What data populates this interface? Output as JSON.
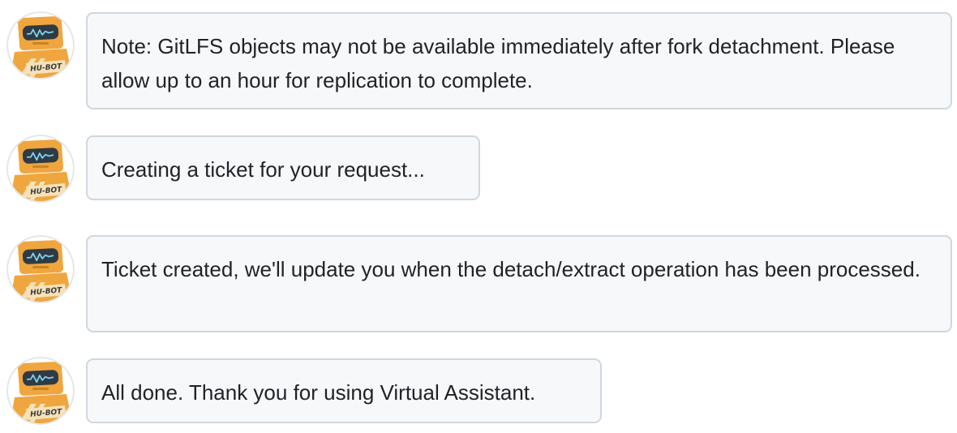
{
  "avatar": {
    "icon": "hubot-robot-avatar",
    "label": "HU-BOT",
    "colors": {
      "ring": "#e3e6ea",
      "body": "#f0a63e",
      "stripe": "#f5e2b9",
      "visor": "#2f3a45",
      "screen_line": "#7fd3e8"
    }
  },
  "colors": {
    "bubble_bg": "#f6f8fa",
    "bubble_border": "#d0d7de",
    "text": "#1f2328"
  },
  "messages": [
    {
      "text": "Note: GitLFS objects may not be available immediately after fork detachment. Please allow up to an hour for replication to complete."
    },
    {
      "text": "Creating a ticket for your request..."
    },
    {
      "text": "Ticket created, we'll update you when the detach/extract operation has been processed."
    },
    {
      "text": "All done. Thank you for using Virtual Assistant."
    }
  ]
}
